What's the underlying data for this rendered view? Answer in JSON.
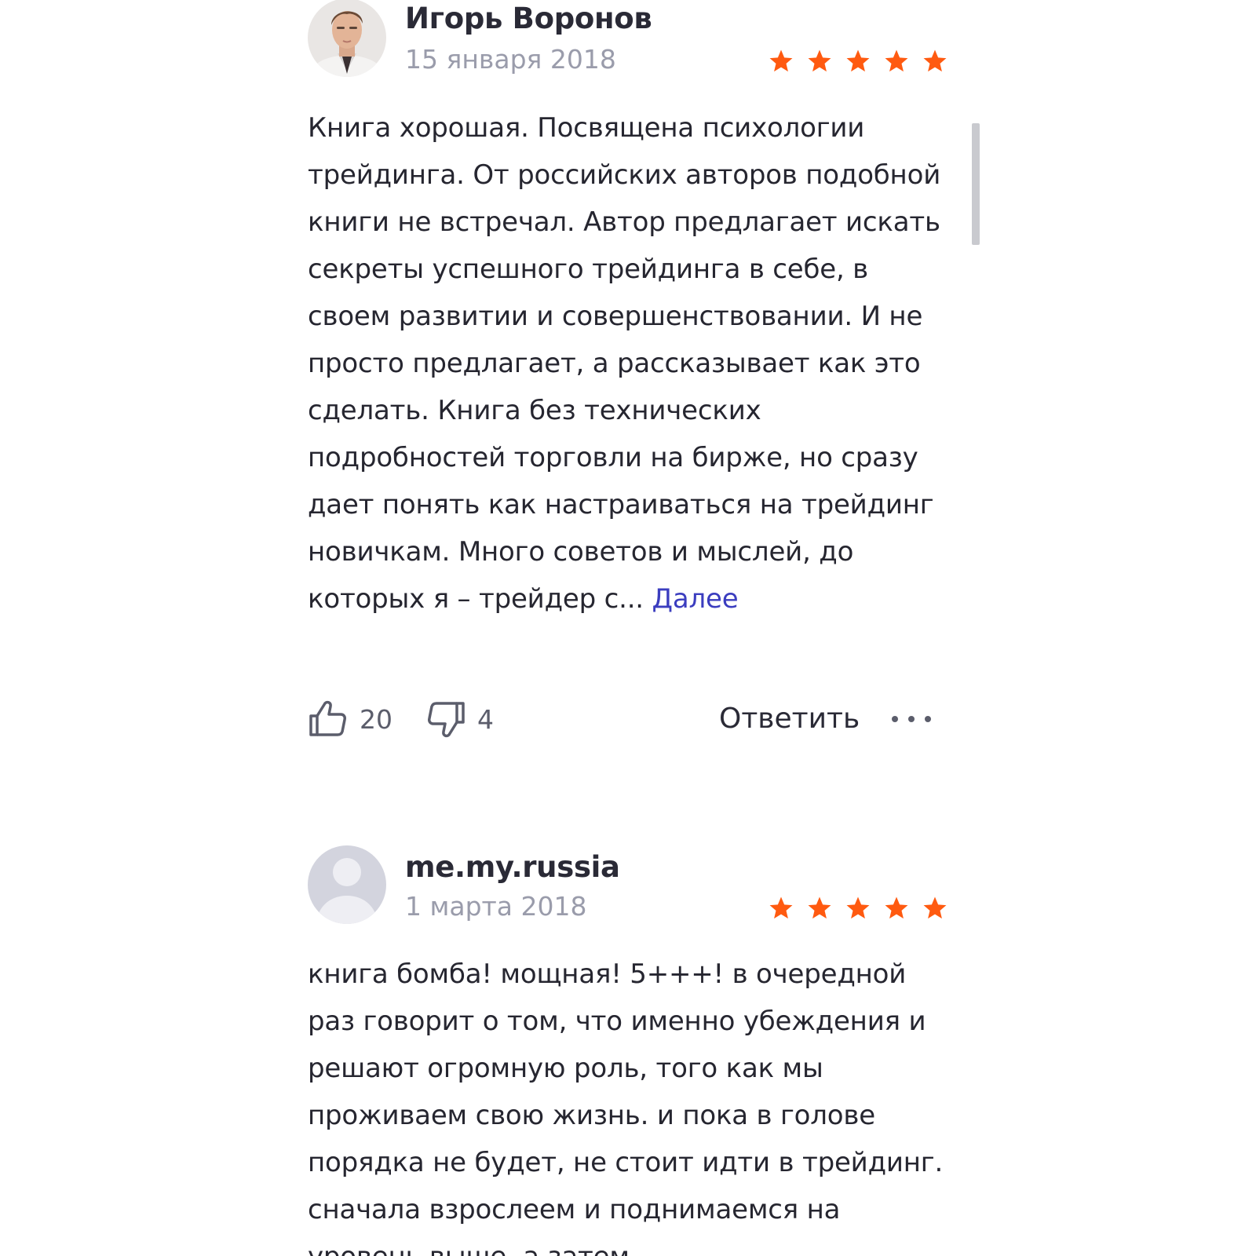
{
  "reviews": [
    {
      "author": "Игорь Воронов",
      "date": "15 января 2018",
      "rating": 5,
      "text": "Книга хорошая. Посвящена психологии трейдинга. От российских авторов подобной книги не встречал. Автор предлагает искать секреты успешного трейдинга в себе, в своем развитии и совершенствовании. И не просто предлагает, а рассказывает как это сделать. Книга без технических подробностей торговли на бирже, но сразу дает понять как настраиваться на трейдинг новичкам. Много советов и мыслей, до которых я – трейдер с...",
      "more_label": "Далее",
      "likes": "20",
      "dislikes": "4",
      "reply_label": "Ответить"
    },
    {
      "author": "me.my.russia",
      "date": "1 марта 2018",
      "rating": 5,
      "text": "книга бомба! мощная! 5+++! в очередной раз говорит о том, что именно убеждения и решают огромную роль, того как мы проживаем свою жизнь. и пока в голове порядка не будет, не стоит идти в трейдинг. сначала взрослеем и поднимаемся на уровень выше, а затем"
    }
  ],
  "icons": {
    "star": "star-icon",
    "like": "thumbs-up-icon",
    "dislike": "thumbs-down-icon",
    "more": "more-dots-icon",
    "avatar_placeholder": "user-placeholder-icon"
  },
  "colors": {
    "star": "#ff5a10",
    "link": "#3b3dbf",
    "date": "#9a9cab",
    "text": "#262630",
    "scrollbar": "#c9cacf"
  }
}
